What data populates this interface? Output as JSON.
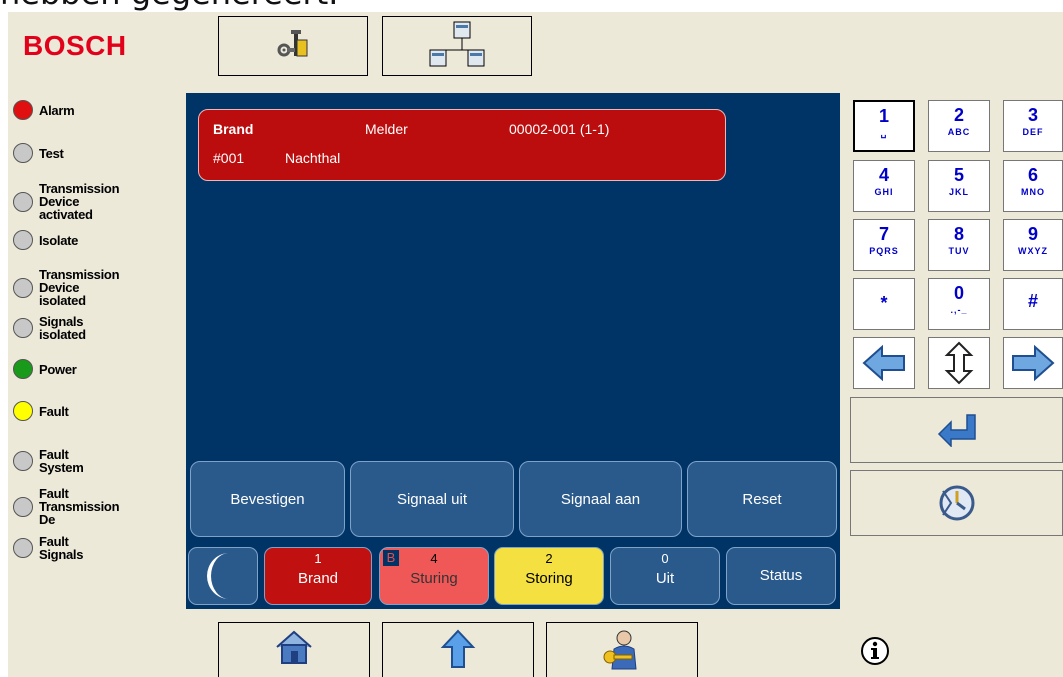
{
  "caption": "hebben gegenereert.",
  "brand": "BOSCH",
  "leds": [
    {
      "label": "Alarm",
      "color": "#e01010"
    },
    {
      "label": "Test",
      "color": "#c8c8c8"
    },
    {
      "label": "Transmission\nDevice activated",
      "color": "#c8c8c8"
    },
    {
      "label": "Isolate",
      "color": "#c8c8c8"
    },
    {
      "label": "Transmission\nDevice isolated",
      "color": "#c8c8c8"
    },
    {
      "label": "Signals isolated",
      "color": "#c8c8c8"
    },
    {
      "label": "Power",
      "color": "#1a9a1a"
    },
    {
      "label": "Fault",
      "color": "#ffff00"
    },
    {
      "label": "Fault System",
      "color": "#c8c8c8"
    },
    {
      "label": "Fault\nTransmission De",
      "color": "#c8c8c8"
    },
    {
      "label": "Fault Signals",
      "color": "#c8c8c8"
    }
  ],
  "alarm": {
    "type": "Brand",
    "device": "Melder",
    "address": "00002-001 (1-1)",
    "number": "#001",
    "location": "Nachthal"
  },
  "actions": [
    "Bevestigen",
    "Signaal uit",
    "Signaal aan",
    "Reset"
  ],
  "tabs": {
    "brand": {
      "count": "1",
      "label": "Brand",
      "color": "#c01010"
    },
    "sturing": {
      "count": "4",
      "label": "Sturing",
      "badge": "B",
      "color": "#f05858"
    },
    "storing": {
      "count": "2",
      "label": "Storing",
      "color": "#f4e040"
    },
    "uit": {
      "count": "0",
      "label": "Uit",
      "color": "#2a5a8c"
    },
    "status": {
      "label": "Status",
      "color": "#2a5a8c"
    }
  },
  "keypad": [
    {
      "d": "1",
      "s": "␣"
    },
    {
      "d": "2",
      "s": "ABC"
    },
    {
      "d": "3",
      "s": "DEF"
    },
    {
      "d": "4",
      "s": "GHI"
    },
    {
      "d": "5",
      "s": "JKL"
    },
    {
      "d": "6",
      "s": "MNO"
    },
    {
      "d": "7",
      "s": "PQRS"
    },
    {
      "d": "8",
      "s": "TUV"
    },
    {
      "d": "9",
      "s": "WXYZ"
    },
    {
      "d": "*",
      "s": ""
    },
    {
      "d": "0",
      "s": ".,-_"
    },
    {
      "d": "#",
      "s": ""
    }
  ],
  "colors": {
    "screen": "#003366",
    "accent": "#2a5a8c",
    "brand": "#e2001a"
  }
}
